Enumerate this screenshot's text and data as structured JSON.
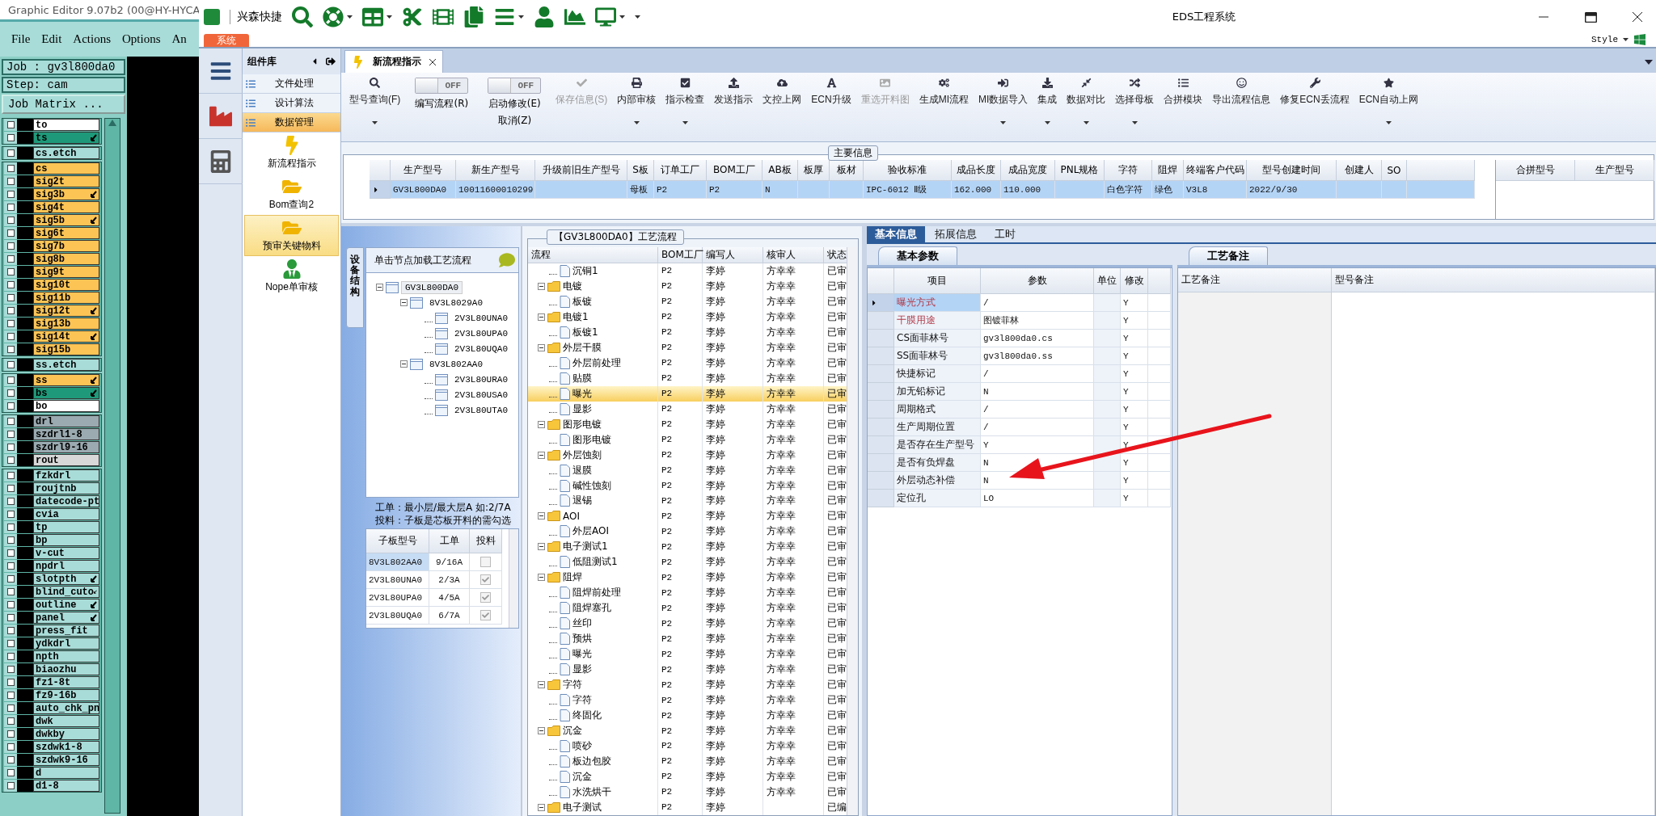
{
  "legacy": {
    "title": "Graphic Editor 9.07b2 (00@HY-HYCA",
    "menu": [
      "File",
      "Edit",
      "Actions",
      "Options",
      "An"
    ],
    "job": "Job : gv3l800da0",
    "step": "Step: cam",
    "matrix_button": "Job Matrix ...",
    "layer_groups": [
      {
        "layers": [
          {
            "name": "to",
            "color": "#ffffff",
            "flag": false,
            "checked": false
          },
          {
            "name": "ts",
            "color": "#1e9a7a",
            "flag": true,
            "checked": false
          }
        ]
      },
      {
        "layers": [
          {
            "name": "cs.etch",
            "color": "#a8dcd8",
            "flag": false,
            "checked": false
          }
        ]
      },
      {
        "layers": [
          {
            "name": "cs",
            "color": "#fcc455",
            "flag": false,
            "checked": false
          },
          {
            "name": "sig2t",
            "color": "#fcc455",
            "flag": false,
            "checked": false
          },
          {
            "name": "sig3b",
            "color": "#fcc455",
            "flag": true,
            "checked": false
          },
          {
            "name": "sig4t",
            "color": "#fcc455",
            "flag": false,
            "checked": false
          },
          {
            "name": "sig5b",
            "color": "#fcc455",
            "flag": true,
            "checked": false
          },
          {
            "name": "sig6t",
            "color": "#fcc455",
            "flag": false,
            "checked": false
          },
          {
            "name": "sig7b",
            "color": "#fcc455",
            "flag": false,
            "checked": false
          },
          {
            "name": "sig8b",
            "color": "#fcc455",
            "flag": false,
            "checked": false
          },
          {
            "name": "sig9t",
            "color": "#fcc455",
            "flag": false,
            "checked": false
          },
          {
            "name": "sig10t",
            "color": "#fcc455",
            "flag": false,
            "checked": false
          },
          {
            "name": "sig11b",
            "color": "#fcc455",
            "flag": false,
            "checked": false
          },
          {
            "name": "sig12t",
            "color": "#fcc455",
            "flag": true,
            "checked": false
          },
          {
            "name": "sig13b",
            "color": "#fcc455",
            "flag": false,
            "checked": false
          },
          {
            "name": "sig14t",
            "color": "#fcc455",
            "flag": true,
            "checked": false
          },
          {
            "name": "sig15b",
            "color": "#fcc455",
            "flag": false,
            "checked": false
          }
        ]
      },
      {
        "layers": [
          {
            "name": "ss.etch",
            "color": "#a8dcd8",
            "flag": false,
            "checked": false
          }
        ]
      },
      {
        "layers": [
          {
            "name": "ss",
            "color": "#fcc455",
            "flag": true,
            "checked": false
          },
          {
            "name": "bs",
            "color": "#1e9a7a",
            "flag": true,
            "checked": false
          },
          {
            "name": "bo",
            "color": "#ffffff",
            "flag": false,
            "checked": false
          }
        ]
      },
      {
        "layers": [
          {
            "name": "drl",
            "color": "#9aaab0",
            "flag": false,
            "checked": false
          },
          {
            "name": "szdrl1-8",
            "color": "#9aaab0",
            "flag": false,
            "checked": false
          },
          {
            "name": "szdrl9-16",
            "color": "#9aaab0",
            "flag": false,
            "checked": false
          },
          {
            "name": "rout",
            "color": "#d8d8d8",
            "flag": false,
            "checked": false
          }
        ]
      },
      {
        "layers": [
          {
            "name": "fzkdrl",
            "color": "#a8dcd8",
            "flag": false,
            "checked": false
          },
          {
            "name": "roujtnb",
            "color": "#a8dcd8",
            "flag": false,
            "checked": false
          },
          {
            "name": "datecode-pt",
            "color": "#a8dcd8",
            "flag": false,
            "checked": false
          },
          {
            "name": "cvia",
            "color": "#a8dcd8",
            "flag": false,
            "checked": false
          },
          {
            "name": "tp",
            "color": "#a8dcd8",
            "flag": false,
            "checked": false
          },
          {
            "name": "bp",
            "color": "#a8dcd8",
            "flag": false,
            "checked": false
          },
          {
            "name": "v-cut",
            "color": "#a8dcd8",
            "flag": false,
            "checked": false
          },
          {
            "name": "npdrl",
            "color": "#a8dcd8",
            "flag": false,
            "checked": false
          },
          {
            "name": "slotpth",
            "color": "#a8dcd8",
            "flag": true,
            "checked": false
          },
          {
            "name": "blind_cuto",
            "color": "#a8dcd8",
            "flag": true,
            "checked": false
          },
          {
            "name": "outline",
            "color": "#a8dcd8",
            "flag": true,
            "checked": false
          },
          {
            "name": "panel",
            "color": "#a8dcd8",
            "flag": true,
            "checked": false
          },
          {
            "name": "press_fit",
            "color": "#a8dcd8",
            "flag": false,
            "checked": false
          },
          {
            "name": "ydkdrl",
            "color": "#a8dcd8",
            "flag": false,
            "checked": false
          },
          {
            "name": "npth",
            "color": "#a8dcd8",
            "flag": false,
            "checked": false
          },
          {
            "name": "biaozhu",
            "color": "#a8dcd8",
            "flag": false,
            "checked": false
          },
          {
            "name": "fz1-8t",
            "color": "#a8dcd8",
            "flag": false,
            "checked": false
          },
          {
            "name": "fz9-16b",
            "color": "#a8dcd8",
            "flag": false,
            "checked": false
          },
          {
            "name": "auto_chk_pn",
            "color": "#a8dcd8",
            "flag": false,
            "checked": false
          },
          {
            "name": "dwk",
            "color": "#a8dcd8",
            "flag": false,
            "checked": false
          },
          {
            "name": "dwkby",
            "color": "#a8dcd8",
            "flag": false,
            "checked": false
          },
          {
            "name": "szdwk1-8",
            "color": "#a8dcd8",
            "flag": false,
            "checked": false
          },
          {
            "name": "szdwk9-16",
            "color": "#a8dcd8",
            "flag": false,
            "checked": false
          },
          {
            "name": "d",
            "color": "#a8dcd8",
            "flag": false,
            "checked": false
          },
          {
            "name": "d1-8",
            "color": "#a8dcd8",
            "flag": false,
            "checked": false
          }
        ]
      }
    ]
  },
  "app": {
    "brand": "兴森快捷",
    "title": "EDS工程系统",
    "system_tab": "系统",
    "style_menu": "Style"
  },
  "component_library": {
    "title": "组件库",
    "categories": [
      {
        "label": "文件处理",
        "selected": false
      },
      {
        "label": "设计算法",
        "selected": false
      },
      {
        "label": "数据管理",
        "selected": true
      }
    ],
    "modules": [
      {
        "label": "新流程指示",
        "selected": false
      },
      {
        "label": "Bom查询2",
        "selected": false
      },
      {
        "label": "预审关键物料",
        "selected": true
      },
      {
        "label": "Nope单审核",
        "selected": false
      }
    ]
  },
  "document_tab": {
    "label": "新流程指示"
  },
  "ribbon": [
    {
      "kind": "button",
      "label": "型号查询(F)",
      "disabled": false,
      "dropdown": true
    },
    {
      "kind": "toggle",
      "label": "编写流程(R)",
      "state_text": "OFF",
      "on": false
    },
    {
      "kind": "toggle",
      "label": "启动修改(E)",
      "sublabel": "取消(Z)",
      "state_text": "OFF",
      "on": false
    },
    {
      "kind": "button",
      "label": "保存信息(S)",
      "disabled": true,
      "dropdown": false
    },
    {
      "kind": "button",
      "label": "内部审核",
      "disabled": false,
      "dropdown": true
    },
    {
      "kind": "button",
      "label": "指示检查",
      "disabled": false,
      "dropdown": true
    },
    {
      "kind": "button",
      "label": "发送指示",
      "disabled": false,
      "dropdown": false
    },
    {
      "kind": "button",
      "label": "文控上网",
      "disabled": false,
      "dropdown": false
    },
    {
      "kind": "button",
      "label": "ECN升级",
      "disabled": false,
      "dropdown": false
    },
    {
      "kind": "button",
      "label": "重选开料图",
      "disabled": true,
      "dropdown": false
    },
    {
      "kind": "button",
      "label": "生成MI流程",
      "disabled": false,
      "dropdown": false
    },
    {
      "kind": "button",
      "label": "MI数据导入",
      "disabled": false,
      "dropdown": true
    },
    {
      "kind": "button",
      "label": "集成",
      "disabled": false,
      "dropdown": true
    },
    {
      "kind": "button",
      "label": "数据对比",
      "disabled": false,
      "dropdown": true
    },
    {
      "kind": "button",
      "label": "选择母板",
      "disabled": false,
      "dropdown": true
    },
    {
      "kind": "button",
      "label": "合拼模块",
      "disabled": false,
      "dropdown": false
    },
    {
      "kind": "button",
      "label": "导出流程信息",
      "disabled": false,
      "dropdown": false
    },
    {
      "kind": "button",
      "label": "修复ECN丢流程",
      "disabled": false,
      "dropdown": false
    },
    {
      "kind": "button",
      "label": "ECN自动上网",
      "disabled": false,
      "dropdown": true
    }
  ],
  "main_info": {
    "title": "主要信息",
    "columns": [
      "生产型号",
      "新生产型号",
      "升级前旧生产型号",
      "S板",
      "订单工厂",
      "BOM工厂",
      "AB板",
      "板厚",
      "板材",
      "验收标准",
      "成品长度",
      "成品宽度",
      "PNL规格",
      "字符",
      "阻焊",
      "终端客户代码",
      "型号创建时间",
      "创建人",
      "SO"
    ],
    "rows": [
      {
        "selected": true,
        "cells": [
          "GV3L800DA0",
          "10011600010299",
          null,
          "母板",
          "P2",
          "P2",
          "N",
          null,
          null,
          "IPC-6012 Ⅱ级",
          "162.000",
          "110.000",
          null,
          "白色字符",
          "绿色",
          "V3L8",
          "2022/9/30",
          null,
          null
        ]
      }
    ],
    "side_columns": [
      "合拼型号",
      "生产型号"
    ]
  },
  "structure": {
    "tab": "设备结构",
    "header": "单击节点加载工艺流程",
    "tree": [
      {
        "label": "GV3L800DA0",
        "selected": true,
        "expanded": true,
        "children": [
          {
            "label": "8V3L8029A0",
            "selected": false,
            "expanded": true,
            "children": [
              {
                "label": "2V3L80UNA0",
                "selected": false
              },
              {
                "label": "2V3L80UPA0",
                "selected": false
              },
              {
                "label": "2V3L80UQA0",
                "selected": false
              }
            ]
          },
          {
            "label": "8V3L802AA0",
            "selected": false,
            "expanded": true,
            "children": [
              {
                "label": "2V3L80URA0",
                "selected": false
              },
              {
                "label": "2V3L80USA0",
                "selected": false
              },
              {
                "label": "2V3L80UTA0",
                "selected": false
              }
            ]
          }
        ]
      }
    ],
    "notes": [
      "工单：最小层/最大层A 如:2/7A",
      "投料：子板是芯板开料的需勾选"
    ],
    "sub_table": {
      "columns": [
        "子板型号",
        "工单",
        "投料"
      ],
      "rows": [
        {
          "board": "8V3L802AA0",
          "order": "9/16A",
          "checked": false,
          "selected": true
        },
        {
          "board": "2V3L80UNA0",
          "order": "2/3A",
          "checked": true,
          "selected": false
        },
        {
          "board": "2V3L80UPA0",
          "order": "4/5A",
          "checked": true,
          "selected": false
        },
        {
          "board": "2V3L80UQA0",
          "order": "6/7A",
          "checked": true,
          "selected": false
        }
      ]
    }
  },
  "flow": {
    "title": "【GV3L800DA0】工艺流程",
    "columns": [
      "流程",
      "BOM工厂",
      "编写人",
      "核审人",
      "状态"
    ],
    "groups": [
      {
        "children": [
          {
            "name": "沉铜1",
            "factory": "P2",
            "writer": "李婷",
            "reviewer": "方幸幸",
            "status": "已审",
            "selected": false
          }
        ]
      },
      {
        "name": "电镀",
        "factory": "P2",
        "writer": "李婷",
        "reviewer": "方幸幸",
        "status": "已审",
        "selected": false,
        "expanded": true,
        "children": [
          {
            "name": "板镀",
            "factory": "P2",
            "writer": "李婷",
            "reviewer": "方幸幸",
            "status": "已审",
            "selected": false
          }
        ]
      },
      {
        "name": "电镀1",
        "factory": "P2",
        "writer": "李婷",
        "reviewer": "方幸幸",
        "status": "已审",
        "selected": false,
        "expanded": true,
        "children": [
          {
            "name": "板镀1",
            "factory": "P2",
            "writer": "李婷",
            "reviewer": "方幸幸",
            "status": "已审",
            "selected": false
          }
        ]
      },
      {
        "name": "外层干膜",
        "factory": "P2",
        "writer": "李婷",
        "reviewer": "方幸幸",
        "status": "已审",
        "selected": false,
        "expanded": true,
        "children": [
          {
            "name": "外层前处理",
            "factory": "P2",
            "writer": "李婷",
            "reviewer": "方幸幸",
            "status": "已审",
            "selected": false
          },
          {
            "name": "贴膜",
            "factory": "P2",
            "writer": "李婷",
            "reviewer": "方幸幸",
            "status": "已审",
            "selected": false
          },
          {
            "name": "曝光",
            "factory": "P2",
            "writer": "李婷",
            "reviewer": "方幸幸",
            "status": "已审",
            "selected": true
          },
          {
            "name": "显影",
            "factory": "P2",
            "writer": "李婷",
            "reviewer": "方幸幸",
            "status": "已审",
            "selected": false
          }
        ]
      },
      {
        "name": "图形电镀",
        "factory": "P2",
        "writer": "李婷",
        "reviewer": "方幸幸",
        "status": "已审",
        "selected": false,
        "expanded": true,
        "children": [
          {
            "name": "图形电镀",
            "factory": "P2",
            "writer": "李婷",
            "reviewer": "方幸幸",
            "status": "已审",
            "selected": false
          }
        ]
      },
      {
        "name": "外层蚀刻",
        "factory": "P2",
        "writer": "李婷",
        "reviewer": "方幸幸",
        "status": "已审",
        "selected": false,
        "expanded": true,
        "children": [
          {
            "name": "退膜",
            "factory": "P2",
            "writer": "李婷",
            "reviewer": "方幸幸",
            "status": "已审",
            "selected": false
          },
          {
            "name": "碱性蚀刻",
            "factory": "P2",
            "writer": "李婷",
            "reviewer": "方幸幸",
            "status": "已审",
            "selected": false
          },
          {
            "name": "退锡",
            "factory": "P2",
            "writer": "李婷",
            "reviewer": "方幸幸",
            "status": "已审",
            "selected": false
          }
        ]
      },
      {
        "name": "AOI",
        "factory": "P2",
        "writer": "李婷",
        "reviewer": "方幸幸",
        "status": "已审",
        "selected": false,
        "expanded": true,
        "children": [
          {
            "name": "外层AOI",
            "factory": "P2",
            "writer": "李婷",
            "reviewer": "方幸幸",
            "status": "已审",
            "selected": false
          }
        ]
      },
      {
        "name": "电子测试1",
        "factory": "P2",
        "writer": "李婷",
        "reviewer": "方幸幸",
        "status": "已审",
        "selected": false,
        "expanded": true,
        "children": [
          {
            "name": "低阻测试1",
            "factory": "P2",
            "writer": "李婷",
            "reviewer": "方幸幸",
            "status": "已审",
            "selected": false
          }
        ]
      },
      {
        "name": "阻焊",
        "factory": "P2",
        "writer": "李婷",
        "reviewer": "方幸幸",
        "status": "已审",
        "selected": false,
        "expanded": true,
        "children": [
          {
            "name": "阻焊前处理",
            "factory": "P2",
            "writer": "李婷",
            "reviewer": "方幸幸",
            "status": "已审",
            "selected": false
          },
          {
            "name": "阻焊塞孔",
            "factory": "P2",
            "writer": "李婷",
            "reviewer": "方幸幸",
            "status": "已审",
            "selected": false
          },
          {
            "name": "丝印",
            "factory": "P2",
            "writer": "李婷",
            "reviewer": "方幸幸",
            "status": "已审",
            "selected": false
          },
          {
            "name": "预烘",
            "factory": "P2",
            "writer": "李婷",
            "reviewer": "方幸幸",
            "status": "已审",
            "selected": false
          },
          {
            "name": "曝光",
            "factory": "P2",
            "writer": "李婷",
            "reviewer": "方幸幸",
            "status": "已审",
            "selected": false
          },
          {
            "name": "显影",
            "factory": "P2",
            "writer": "李婷",
            "reviewer": "方幸幸",
            "status": "已审",
            "selected": false
          }
        ]
      },
      {
        "name": "字符",
        "factory": "P2",
        "writer": "李婷",
        "reviewer": "方幸幸",
        "status": "已审",
        "selected": false,
        "expanded": true,
        "children": [
          {
            "name": "字符",
            "factory": "P2",
            "writer": "李婷",
            "reviewer": "方幸幸",
            "status": "已审",
            "selected": false
          },
          {
            "name": "终固化",
            "factory": "P2",
            "writer": "李婷",
            "reviewer": "方幸幸",
            "status": "已审",
            "selected": false
          }
        ]
      },
      {
        "name": "沉金",
        "factory": "P2",
        "writer": "李婷",
        "reviewer": "方幸幸",
        "status": "已审",
        "selected": false,
        "expanded": true,
        "children": [
          {
            "name": "喷砂",
            "factory": "P2",
            "writer": "李婷",
            "reviewer": "方幸幸",
            "status": "已审",
            "selected": false
          },
          {
            "name": "板边包胶",
            "factory": "P2",
            "writer": "李婷",
            "reviewer": "方幸幸",
            "status": "已审",
            "selected": false
          },
          {
            "name": "沉金",
            "factory": "P2",
            "writer": "李婷",
            "reviewer": "方幸幸",
            "status": "已审",
            "selected": false
          },
          {
            "name": "水洗烘干",
            "factory": "P2",
            "writer": "李婷",
            "reviewer": "方幸幸",
            "status": "已审",
            "selected": false
          }
        ]
      },
      {
        "name": "电子测试",
        "factory": "P2",
        "writer": "李婷",
        "status": "已编",
        "selected": false,
        "expanded": true
      }
    ]
  },
  "details": {
    "tabs": [
      {
        "label": "基本信息",
        "selected": true
      },
      {
        "label": "拓展信息",
        "selected": false
      },
      {
        "label": "工时",
        "selected": false
      }
    ],
    "params": {
      "title": "基本参数",
      "columns": [
        "项目",
        "参数",
        "单位",
        "修改"
      ],
      "rows": [
        {
          "item": "曝光方式",
          "value": "/",
          "modify": "Y",
          "required": true,
          "selected": true
        },
        {
          "item": "干膜用途",
          "value": "图镀菲林",
          "modify": "Y",
          "required": true,
          "selected": false
        },
        {
          "item": "CS面菲林号",
          "value": "gv3l800da0.cs",
          "modify": "Y",
          "required": false,
          "selected": false
        },
        {
          "item": "SS面菲林号",
          "value": "gv3l800da0.ss",
          "modify": "Y",
          "required": false,
          "selected": false
        },
        {
          "item": "快捷标记",
          "value": "/",
          "modify": "Y",
          "required": false,
          "selected": false
        },
        {
          "item": "加无铅标记",
          "value": "N",
          "modify": "Y",
          "required": false,
          "selected": false
        },
        {
          "item": "周期格式",
          "value": "/",
          "modify": "Y",
          "required": false,
          "selected": false
        },
        {
          "item": "生产周期位置",
          "value": "/",
          "modify": "Y",
          "required": false,
          "selected": false
        },
        {
          "item": "是否存在生产型号",
          "value": "Y",
          "modify": "Y",
          "required": false,
          "selected": false
        },
        {
          "item": "是否有负焊盘",
          "value": "N",
          "modify": "Y",
          "required": false,
          "selected": false
        },
        {
          "item": "外层动态补偿",
          "value": "N",
          "modify": "Y",
          "required": false,
          "selected": false
        },
        {
          "item": "定位孔",
          "value": "LO",
          "modify": "Y",
          "required": false,
          "selected": false
        }
      ]
    },
    "remarks": {
      "title": "工艺备注",
      "columns": [
        "工艺备注",
        "型号备注"
      ]
    }
  }
}
